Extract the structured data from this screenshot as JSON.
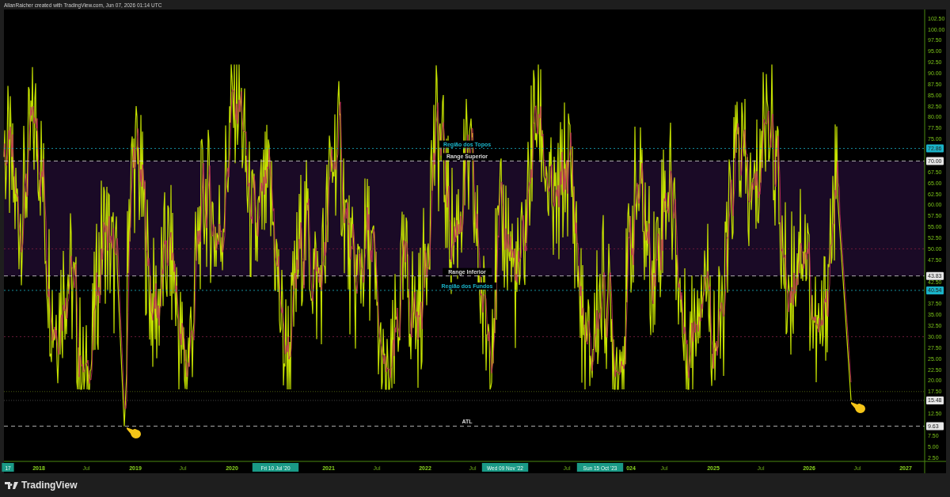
{
  "header": {
    "text": "AllanRaicher created with TradingView.com, Jun 07, 2026 01:14 UTC"
  },
  "level_lines": [
    {
      "label": "Região dos Topos",
      "kind": "dotted",
      "color": "#1ab3c8"
    },
    {
      "label": "Range Superior",
      "kind": "dashed",
      "color": "#d8d8d8"
    },
    {
      "label": "Range Inferior",
      "kind": "dashed",
      "color": "#d8d8d8"
    },
    {
      "label": "Região dos Fundos",
      "kind": "dotted",
      "color": "#1ab3c8"
    },
    {
      "label": "ATL",
      "kind": "dashed",
      "color": "#d8d8d8"
    }
  ],
  "price_axis": {
    "ticks": [
      "102.50",
      "100.00",
      "97.50",
      "95.00",
      "92.50",
      "90.00",
      "87.50",
      "85.00",
      "82.50",
      "80.00",
      "77.50",
      "75.00",
      "67.50",
      "65.00",
      "62.50",
      "60.00",
      "57.50",
      "55.00",
      "52.50",
      "50.00",
      "47.50",
      "42.50",
      "37.50",
      "35.00",
      "32.50",
      "30.00",
      "27.50",
      "25.00",
      "22.50",
      "20.00",
      "17.50",
      "12.50",
      "7.50",
      "5.00",
      "2.50"
    ],
    "badges": [
      {
        "text": "72.86",
        "color": "#1ab3c8"
      },
      {
        "text": "70.00",
        "color": "#e6e6e6"
      },
      {
        "text": "43.83",
        "color": "#e6e6e6"
      },
      {
        "text": "40.54",
        "color": "#1ab3c8"
      },
      {
        "text": "15.48",
        "color": "#e6e6e6"
      },
      {
        "text": "9.63",
        "color": "#e6e6e6"
      }
    ]
  },
  "time_axis": [
    {
      "text": "17",
      "kind": "date"
    },
    {
      "text": "2018",
      "kind": "year"
    },
    {
      "text": "Jul",
      "kind": "month"
    },
    {
      "text": "2019",
      "kind": "year"
    },
    {
      "text": "Jul",
      "kind": "month"
    },
    {
      "text": "2020",
      "kind": "year"
    },
    {
      "text": "Fri 10 Jul '20",
      "kind": "date"
    },
    {
      "text": "2021",
      "kind": "year"
    },
    {
      "text": "Jul",
      "kind": "month"
    },
    {
      "text": "2022",
      "kind": "year"
    },
    {
      "text": "Jul",
      "kind": "month"
    },
    {
      "text": "Wed 09 Nov '22",
      "kind": "date"
    },
    {
      "text": "Jul",
      "kind": "month"
    },
    {
      "text": "Sun 15 Oct '23",
      "kind": "date"
    },
    {
      "text": "024",
      "kind": "year"
    },
    {
      "text": "Jul",
      "kind": "month"
    },
    {
      "text": "2025",
      "kind": "year"
    },
    {
      "text": "Jul",
      "kind": "month"
    },
    {
      "text": "2026",
      "kind": "year"
    },
    {
      "text": "Jul",
      "kind": "month"
    },
    {
      "text": "2027",
      "kind": "year"
    }
  ],
  "footer": {
    "logo": "TradingView"
  }
}
